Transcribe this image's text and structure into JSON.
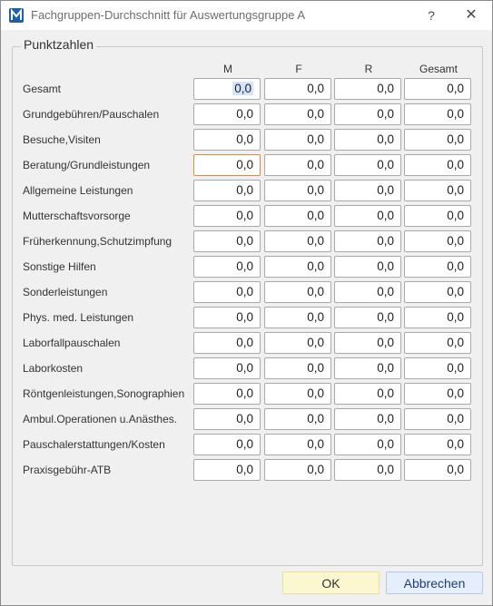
{
  "window": {
    "title": "Fachgruppen-Durchschnitt für Auswertungsgruppe A",
    "help_glyph": "?",
    "close_glyph": "✕"
  },
  "group": {
    "legend": "Punktzahlen",
    "columns": [
      "M",
      "F",
      "R",
      "Gesamt"
    ],
    "rows": [
      {
        "label": "Gesamt",
        "values": [
          "0,0",
          "0,0",
          "0,0",
          "0,0"
        ]
      },
      {
        "label": "Grundgebühren/Pauschalen",
        "values": [
          "0,0",
          "0,0",
          "0,0",
          "0,0"
        ]
      },
      {
        "label": "Besuche,Visiten",
        "values": [
          "0,0",
          "0,0",
          "0,0",
          "0,0"
        ]
      },
      {
        "label": "Beratung/Grundleistungen",
        "values": [
          "0,0",
          "0,0",
          "0,0",
          "0,0"
        ]
      },
      {
        "label": "Allgemeine Leistungen",
        "values": [
          "0,0",
          "0,0",
          "0,0",
          "0,0"
        ]
      },
      {
        "label": "Mutterschaftsvorsorge",
        "values": [
          "0,0",
          "0,0",
          "0,0",
          "0,0"
        ]
      },
      {
        "label": "Früherkennung,Schutzimpfung",
        "values": [
          "0,0",
          "0,0",
          "0,0",
          "0,0"
        ]
      },
      {
        "label": "Sonstige Hilfen",
        "values": [
          "0,0",
          "0,0",
          "0,0",
          "0,0"
        ]
      },
      {
        "label": "Sonderleistungen",
        "values": [
          "0,0",
          "0,0",
          "0,0",
          "0,0"
        ]
      },
      {
        "label": "Phys. med. Leistungen",
        "values": [
          "0,0",
          "0,0",
          "0,0",
          "0,0"
        ]
      },
      {
        "label": "Laborfallpauschalen",
        "values": [
          "0,0",
          "0,0",
          "0,0",
          "0,0"
        ]
      },
      {
        "label": "Laborkosten",
        "values": [
          "0,0",
          "0,0",
          "0,0",
          "0,0"
        ]
      },
      {
        "label": "Röntgenleistungen,Sonographien",
        "values": [
          "0,0",
          "0,0",
          "0,0",
          "0,0"
        ]
      },
      {
        "label": "Ambul.Operationen u.Anästhes.",
        "values": [
          "0,0",
          "0,0",
          "0,0",
          "0,0"
        ]
      },
      {
        "label": "Pauschalerstattungen/Kosten",
        "values": [
          "0,0",
          "0,0",
          "0,0",
          "0,0"
        ]
      },
      {
        "label": "Praxisgebühr-ATB",
        "values": [
          "0,0",
          "0,0",
          "0,0",
          "0,0"
        ]
      }
    ]
  },
  "buttons": {
    "ok": "OK",
    "cancel": "Abbrechen"
  }
}
